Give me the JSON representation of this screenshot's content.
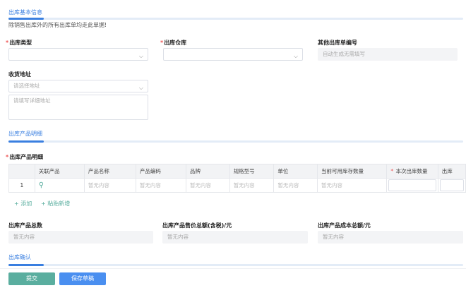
{
  "basic": {
    "title": "出库基本信息",
    "note": "除销售出库外的所有出库单均走此单据!",
    "type_label": "出库类型",
    "warehouse_label": "出库仓库",
    "other_no_label": "其他出库单编号",
    "other_no_placeholder": "自动生成无需填写",
    "address_label": "收货地址",
    "address_placeholder": "请选择地址",
    "address_detail_placeholder": "请填写详细地址",
    "required_mark": "*"
  },
  "products": {
    "title": "出库产品明细",
    "table_label": "出库产品明细",
    "columns": [
      "",
      "关联产品",
      "产品名称",
      "产品编码",
      "品牌",
      "规格型号",
      "单位",
      "当前可用库存数量",
      "本次出库数量",
      "出库"
    ],
    "rows": [
      {
        "index": "1",
        "name": "暂无内容",
        "code": "暂无内容",
        "brand": "暂无内容",
        "spec": "暂无内容",
        "unit": "暂无内容",
        "stock": "暂无内容"
      }
    ],
    "add_label": "添加",
    "paste_label": "粘贴新增"
  },
  "totals": {
    "count_label": "出库产品总数",
    "price_label": "出库产品售价总额(含税)/元",
    "cost_label": "出库产品成本总额/元",
    "empty": "暂无内容"
  },
  "confirm": {
    "title": "出库确认"
  },
  "actions": {
    "submit": "提交",
    "save_draft": "保存草稿"
  },
  "colors": {
    "accent": "#3a7fe0",
    "submit": "#5aae9f",
    "save": "#4a8ff0"
  }
}
